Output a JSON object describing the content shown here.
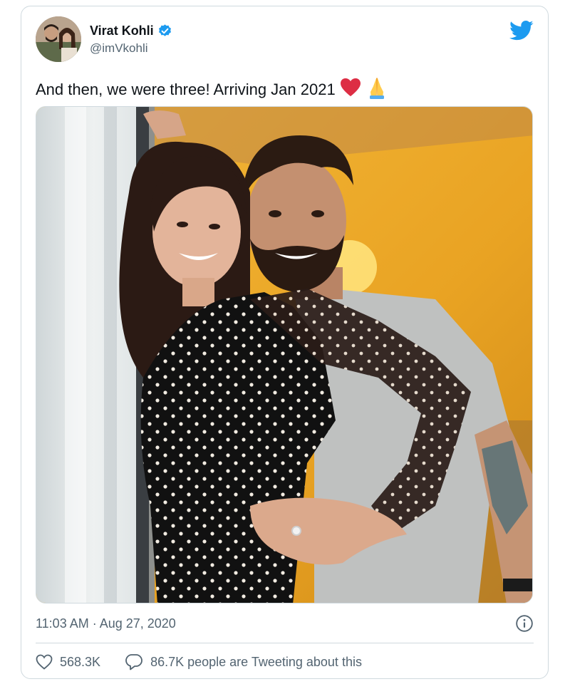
{
  "tweet": {
    "author": {
      "display_name": "Virat Kohli",
      "handle": "@imVkohli",
      "verified": true,
      "verified_icon": "verified-badge-icon",
      "avatar_icon": "avatar"
    },
    "brand_icon": "twitter-bird-icon",
    "brand_color": "#1d9bf0",
    "text": "And then, we were three! Arriving Jan 2021",
    "emoji": [
      "red-heart-icon",
      "folded-hands-icon"
    ],
    "media": {
      "type": "photo",
      "icon": "photo"
    },
    "timestamp": "11:03 AM · Aug 27, 2020",
    "info_icon": "info-icon",
    "actions": {
      "likes_count": "568.3K",
      "like_icon": "heart-outline-icon",
      "conversation_text": "86.7K people are Tweeting about this",
      "conversation_icon": "speech-bubble-icon"
    }
  },
  "colors": {
    "text_primary": "#0f1419",
    "text_secondary": "#536471",
    "border": "#cfd9de",
    "heart_red": "#e0245e"
  }
}
